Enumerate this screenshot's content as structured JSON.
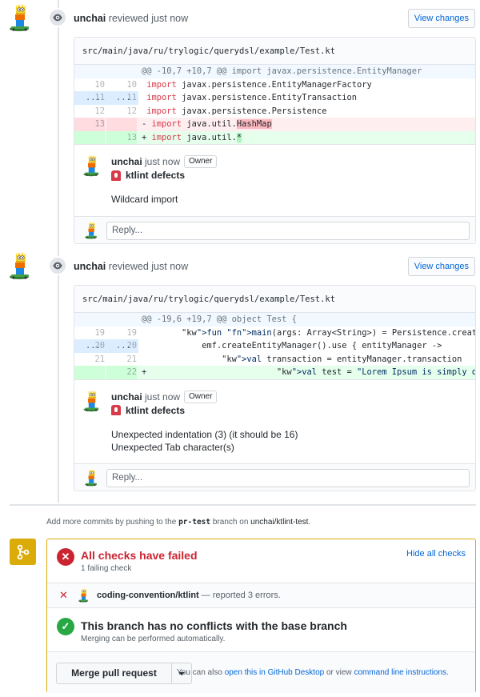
{
  "reviews": [
    {
      "author": "unchai",
      "action": "reviewed just now",
      "view_changes": "View changes",
      "file_path": "src/main/java/ru/trylogic/querydsl/example/Test.kt",
      "hunk": {
        "left": "...",
        "right": "...",
        "text": "@@ -10,7 +10,7 @@ import javax.persistence.EntityManager"
      },
      "lines": [
        {
          "type": "ctx",
          "old": "10",
          "new": "10",
          "prefix": " ",
          "kw": "import",
          "rest": " javax.persistence.EntityManagerFactory"
        },
        {
          "type": "ctx",
          "old": "11",
          "new": "11",
          "prefix": " ",
          "kw": "import",
          "rest": " javax.persistence.EntityTransaction"
        },
        {
          "type": "ctx",
          "old": "12",
          "new": "12",
          "prefix": " ",
          "kw": "import",
          "rest": " javax.persistence.Persistence"
        },
        {
          "type": "del",
          "old": "13",
          "new": "",
          "prefix": "-",
          "kw": "import",
          "rest": " java.util.",
          "hl": "HashMap"
        },
        {
          "type": "add",
          "old": "",
          "new": "13",
          "prefix": "+",
          "kw": "import",
          "rest": " java.util.",
          "hl": "*"
        }
      ],
      "comment": {
        "author": "unchai",
        "time": "just now",
        "badge": "Owner",
        "title": "ktlint defects",
        "body": [
          "Wildcard import"
        ]
      },
      "reply_placeholder": "Reply..."
    },
    {
      "author": "unchai",
      "action": "reviewed just now",
      "view_changes": "View changes",
      "file_path": "src/main/java/ru/trylogic/querydsl/example/Test.kt",
      "hunk": {
        "left": "...",
        "right": "...",
        "text": "@@ -19,6 +19,7 @@ object Test {"
      },
      "lines": [
        {
          "type": "ctx",
          "old": "19",
          "new": "19",
          "text": "        fun main(args: Array<String>) = Persistence.createEntityManagerFactor"
        },
        {
          "type": "ctx",
          "old": "20",
          "new": "20",
          "text": "            emf.createEntityManager().use { entityManager ->"
        },
        {
          "type": "ctx",
          "old": "21",
          "new": "21",
          "text": "                val transaction = entityManager.transaction"
        },
        {
          "type": "add",
          "old": "",
          "new": "22",
          "text": "+                          val test = \"Lorem Ipsum is simply dummy text of the"
        }
      ],
      "comment": {
        "author": "unchai",
        "time": "just now",
        "badge": "Owner",
        "title": "ktlint defects",
        "body": [
          "Unexpected indentation (3) (it should be 16)",
          "Unexpected Tab character(s)"
        ]
      },
      "reply_placeholder": "Reply..."
    }
  ],
  "push_note": {
    "prefix": "Add more commits by pushing to the ",
    "branch": "pr-test",
    "middle": " branch on ",
    "repo": "unchai/ktlint-test",
    "suffix": "."
  },
  "checks": {
    "title": "All checks have failed",
    "subtitle": "1 failing check",
    "hide_label": "Hide all checks",
    "item_name": "coding-convention/ktlint",
    "item_desc": " — reported 3 errors."
  },
  "conflicts": {
    "title": "This branch has no conflicts with the base branch",
    "subtitle": "Merging can be performed automatically."
  },
  "merge": {
    "button": "Merge pull request",
    "help_prefix": "You can also ",
    "help_link1": "open this in GitHub Desktop",
    "help_middle": " or view ",
    "help_link2": "command line instructions",
    "help_suffix": "."
  },
  "colors": {
    "fail": "#cb2431",
    "success": "#28a745",
    "warning": "#dbab09",
    "link": "#0366d6"
  }
}
